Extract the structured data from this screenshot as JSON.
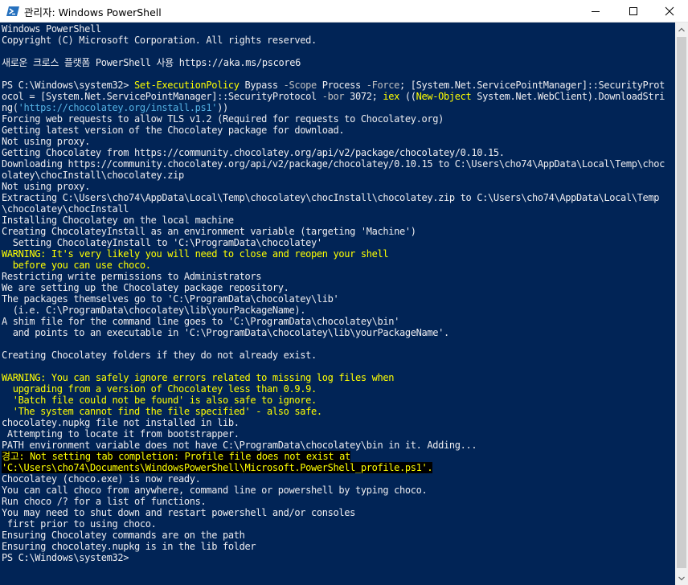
{
  "window": {
    "title": "관리자: Windows PowerShell",
    "icon": "powershell-icon",
    "buttons": {
      "minimize": "minimize-icon",
      "maximize": "maximize-icon",
      "close": "close-icon"
    }
  },
  "colors": {
    "background": "#012456",
    "text": "#eeedf0",
    "warning": "#ffff00",
    "command": "#ffff00",
    "parameter": "#c0c0c0",
    "string": "#55b3e4",
    "highlight_bg": "#000000"
  },
  "console": {
    "lines": [
      [
        {
          "t": "Windows PowerShell",
          "c": "white"
        }
      ],
      [
        {
          "t": "Copyright (C) Microsoft Corporation. All rights reserved.",
          "c": "white"
        }
      ],
      [],
      [
        {
          "t": "새로운 크로스 플랫폼 PowerShell 사용 https://aka.ms/pscore6",
          "c": "white"
        }
      ],
      [],
      [
        {
          "t": "PS C:\\Windows\\system32> ",
          "c": "white"
        },
        {
          "t": "Set-ExecutionPolicy",
          "c": "yellow"
        },
        {
          "t": " Bypass ",
          "c": "white"
        },
        {
          "t": "-Scope",
          "c": "gray"
        },
        {
          "t": " Process ",
          "c": "white"
        },
        {
          "t": "-Force",
          "c": "gray"
        },
        {
          "t": "; [System.Net.ServicePointManager]::SecurityProt",
          "c": "white"
        }
      ],
      [
        {
          "t": "ocol = [System.Net.ServicePointManager]::SecurityProtocol ",
          "c": "white"
        },
        {
          "t": "-bor",
          "c": "gray"
        },
        {
          "t": " 3072; ",
          "c": "white"
        },
        {
          "t": "iex",
          "c": "yellow"
        },
        {
          "t": " ((",
          "c": "white"
        },
        {
          "t": "New-Object",
          "c": "yellow"
        },
        {
          "t": " System.Net.WebClient).DownloadStri",
          "c": "white"
        }
      ],
      [
        {
          "t": "ng(",
          "c": "white"
        },
        {
          "t": "'https://chocolatey.org/install.ps1'",
          "c": "cyan"
        },
        {
          "t": "))",
          "c": "white"
        }
      ],
      [
        {
          "t": "Forcing web requests to allow TLS v1.2 (Required for requests to Chocolatey.org)",
          "c": "white"
        }
      ],
      [
        {
          "t": "Getting latest version of the Chocolatey package for download.",
          "c": "white"
        }
      ],
      [
        {
          "t": "Not using proxy.",
          "c": "white"
        }
      ],
      [
        {
          "t": "Getting Chocolatey from https://community.chocolatey.org/api/v2/package/chocolatey/0.10.15.",
          "c": "white"
        }
      ],
      [
        {
          "t": "Downloading https://community.chocolatey.org/api/v2/package/chocolatey/0.10.15 to C:\\Users\\cho74\\AppData\\Local\\Temp\\choc",
          "c": "white"
        }
      ],
      [
        {
          "t": "olatey\\chocInstall\\chocolatey.zip",
          "c": "white"
        }
      ],
      [
        {
          "t": "Not using proxy.",
          "c": "white"
        }
      ],
      [
        {
          "t": "Extracting C:\\Users\\cho74\\AppData\\Local\\Temp\\chocolatey\\chocInstall\\chocolatey.zip to C:\\Users\\cho74\\AppData\\Local\\Temp",
          "c": "white"
        }
      ],
      [
        {
          "t": "\\chocolatey\\chocInstall",
          "c": "white"
        }
      ],
      [
        {
          "t": "Installing Chocolatey on the local machine",
          "c": "white"
        }
      ],
      [
        {
          "t": "Creating ChocolateyInstall as an environment variable (targeting 'Machine')",
          "c": "white"
        }
      ],
      [
        {
          "t": "  Setting ChocolateyInstall to 'C:\\ProgramData\\chocolatey'",
          "c": "white"
        }
      ],
      [
        {
          "t": "WARNING: It's very likely you will need to close and reopen your shell",
          "c": "yellow"
        }
      ],
      [
        {
          "t": "  before you can use choco.",
          "c": "yellow"
        }
      ],
      [
        {
          "t": "Restricting write permissions to Administrators",
          "c": "white"
        }
      ],
      [
        {
          "t": "We are setting up the Chocolatey package repository.",
          "c": "white"
        }
      ],
      [
        {
          "t": "The packages themselves go to 'C:\\ProgramData\\chocolatey\\lib'",
          "c": "white"
        }
      ],
      [
        {
          "t": "  (i.e. C:\\ProgramData\\chocolatey\\lib\\yourPackageName).",
          "c": "white"
        }
      ],
      [
        {
          "t": "A shim file for the command line goes to 'C:\\ProgramData\\chocolatey\\bin'",
          "c": "white"
        }
      ],
      [
        {
          "t": "  and points to an executable in 'C:\\ProgramData\\chocolatey\\lib\\yourPackageName'.",
          "c": "white"
        }
      ],
      [],
      [
        {
          "t": "Creating Chocolatey folders if they do not already exist.",
          "c": "white"
        }
      ],
      [],
      [
        {
          "t": "WARNING: You can safely ignore errors related to missing log files when",
          "c": "yellow"
        }
      ],
      [
        {
          "t": "  upgrading from a version of Chocolatey less than 0.9.9.",
          "c": "yellow"
        }
      ],
      [
        {
          "t": "  'Batch file could not be found' is also safe to ignore.",
          "c": "yellow"
        }
      ],
      [
        {
          "t": "  'The system cannot find the file specified' - also safe.",
          "c": "yellow"
        }
      ],
      [
        {
          "t": "chocolatey.nupkg file not installed in lib.",
          "c": "white"
        }
      ],
      [
        {
          "t": " Attempting to locate it from bootstrapper.",
          "c": "white"
        }
      ],
      [
        {
          "t": "PATH environment variable does not have C:\\ProgramData\\chocolatey\\bin in it. Adding...",
          "c": "white"
        }
      ],
      [
        {
          "t": "경고: Not setting tab completion: Profile file does not exist at",
          "c": "yellow",
          "hl": true
        }
      ],
      [
        {
          "t": "'C:\\Users\\cho74\\Documents\\WindowsPowerShell\\Microsoft.PowerShell_profile.ps1'.",
          "c": "yellow",
          "hl": true
        }
      ],
      [
        {
          "t": "Chocolatey (choco.exe) is now ready.",
          "c": "white"
        }
      ],
      [
        {
          "t": "You can call choco from anywhere, command line or powershell by typing choco.",
          "c": "white"
        }
      ],
      [
        {
          "t": "Run choco /? for a list of functions.",
          "c": "white"
        }
      ],
      [
        {
          "t": "You may need to shut down and restart powershell and/or consoles",
          "c": "white"
        }
      ],
      [
        {
          "t": " first prior to using choco.",
          "c": "white"
        }
      ],
      [
        {
          "t": "Ensuring Chocolatey commands are on the path",
          "c": "white"
        }
      ],
      [
        {
          "t": "Ensuring chocolatey.nupkg is in the lib folder",
          "c": "white"
        }
      ],
      [
        {
          "t": "PS C:\\Windows\\system32>",
          "c": "white"
        }
      ]
    ]
  },
  "scrollbar": {
    "up_icon": "scroll-up-arrow-icon",
    "down_icon": "scroll-down-arrow-icon"
  }
}
